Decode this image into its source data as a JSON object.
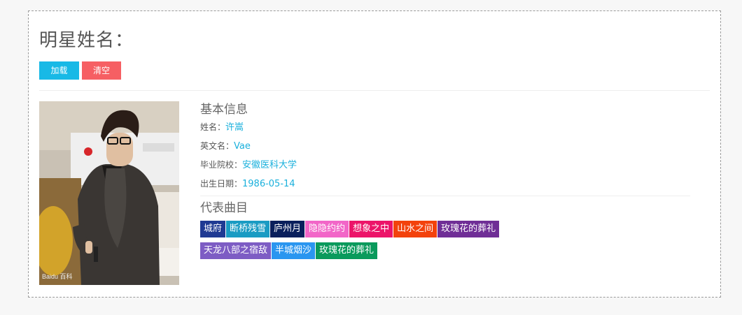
{
  "page": {
    "title": "明星姓名："
  },
  "toolbar": {
    "load_label": "加载",
    "clear_label": "清空"
  },
  "basic_info": {
    "heading": "基本信息",
    "name_label": "姓名：",
    "name_value": "许嵩",
    "english_name_label": "英文名：",
    "english_name_value": "Vae",
    "school_label": "毕业院校：",
    "school_value": "安徽医科大学",
    "birthday_label": "出生日期：",
    "birthday_value": "1986-05-14"
  },
  "songs": {
    "heading": "代表曲目",
    "items": [
      {
        "label": "城府",
        "color": "#1f3a93"
      },
      {
        "label": "断桥残雪",
        "color": "#1a9bc3"
      },
      {
        "label": "庐州月",
        "color": "#0a1f5c"
      },
      {
        "label": "隐隐约约",
        "color": "#f266c8"
      },
      {
        "label": "想象之中",
        "color": "#ec1469"
      },
      {
        "label": "山水之间",
        "color": "#f3420c"
      },
      {
        "label": "玫瑰花的葬礼",
        "color": "#6f2e96"
      },
      {
        "label": "天龙八部之宿敌",
        "color": "#7d5cc4"
      },
      {
        "label": "半城烟沙",
        "color": "#2a96f0"
      },
      {
        "label": "玫瑰花的葬礼",
        "color": "#0a9a5c"
      }
    ]
  },
  "photo": {
    "watermark": "Baidu 百科"
  }
}
